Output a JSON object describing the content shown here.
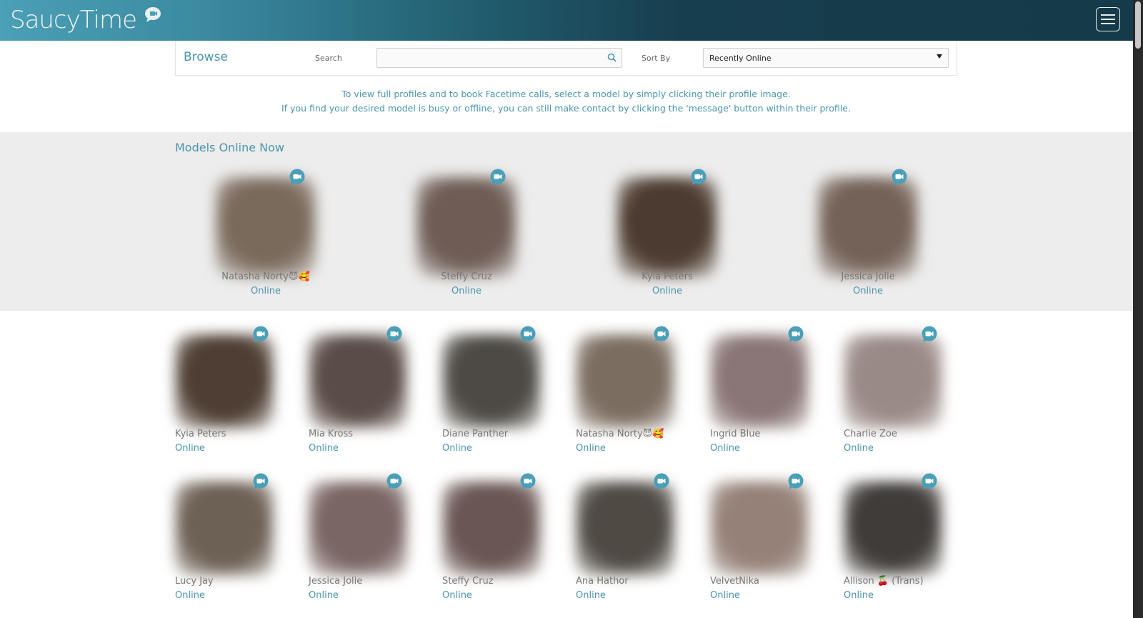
{
  "header": {
    "logo_text": "SaucyTime",
    "menu_label": "menu"
  },
  "browse": {
    "title": "Browse",
    "search_label": "Search",
    "search_placeholder": "",
    "sort_label": "Sort By",
    "sort_value": "Recently Online"
  },
  "intro": {
    "line1": "To view full profiles and to book Facetime calls, select a model by simply clicking their profile image.",
    "line2": "If you find your desired model is busy or offline, you can still make contact by clicking the 'message' button within their profile."
  },
  "online_now": {
    "title": "Models Online Now",
    "models": [
      {
        "name": "Natasha Norty😈🥰",
        "status": "Online",
        "tone": "#7a6a5c"
      },
      {
        "name": "Steffy Cruz",
        "status": "Online",
        "tone": "#6e5c55"
      },
      {
        "name": "Kyia Peters",
        "status": "Online",
        "tone": "#4c3b30"
      },
      {
        "name": "Jessica Jolie",
        "status": "Online",
        "tone": "#746258"
      }
    ]
  },
  "grid": {
    "models": [
      {
        "name": "Kyia Peters",
        "status": "Online",
        "tone": "#4e3e33"
      },
      {
        "name": "Mia Kross",
        "status": "Online",
        "tone": "#5a4c47"
      },
      {
        "name": "Diane Panther",
        "status": "Online",
        "tone": "#4d4a45"
      },
      {
        "name": "Natasha Norty😈🥰",
        "status": "Online",
        "tone": "#7b6d60"
      },
      {
        "name": "Ingrid Blue",
        "status": "Online",
        "tone": "#8a7576"
      },
      {
        "name": "Charlie Zoe",
        "status": "Online",
        "tone": "#9a8a86"
      },
      {
        "name": "Lucy Jay",
        "status": "Online",
        "tone": "#6d6055"
      },
      {
        "name": "Jessica Jolie",
        "status": "Online",
        "tone": "#7a6664"
      },
      {
        "name": "Steffy Cruz",
        "status": "Online",
        "tone": "#6a5754"
      },
      {
        "name": "Ana Hathor",
        "status": "Online",
        "tone": "#4f4a44"
      },
      {
        "name": "VelvetNika",
        "status": "Online",
        "tone": "#958178"
      },
      {
        "name": "Allison 🍒 (Trans)",
        "status": "Online",
        "tone": "#3f3c3a"
      }
    ]
  },
  "colors": {
    "accent": "#4a95ad",
    "badge": "#4a9fb7"
  }
}
